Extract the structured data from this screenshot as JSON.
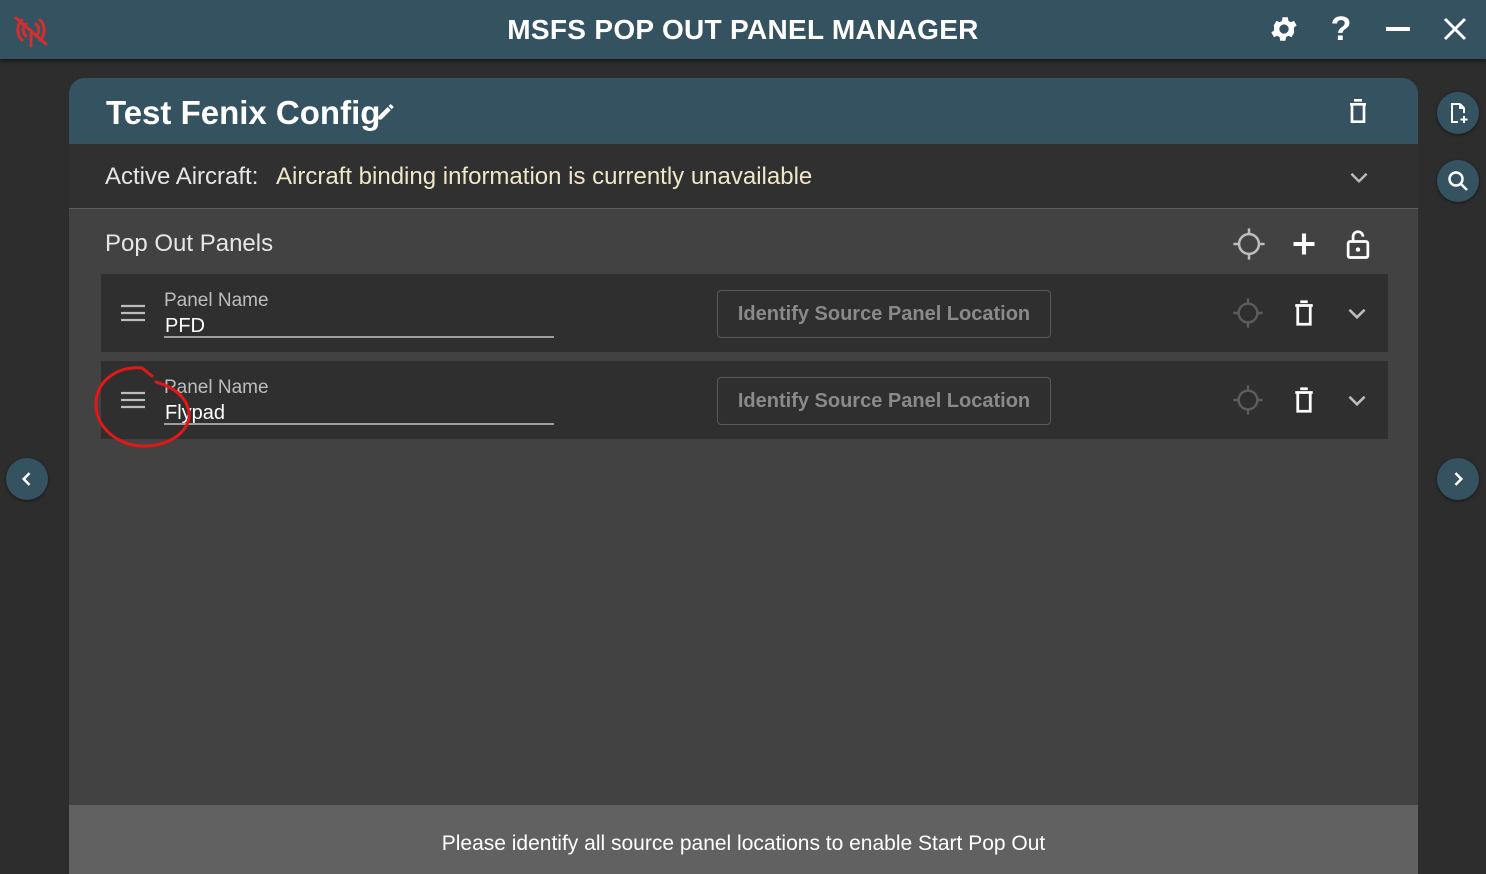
{
  "app": {
    "title": "MSFS POP OUT PANEL MANAGER",
    "accent_color": "#355261",
    "connection_status_color": "#d32f2f"
  },
  "titlebar": {
    "icons": [
      "connection-error-icon",
      "gear-icon",
      "help-icon",
      "minimize-icon",
      "close-icon"
    ]
  },
  "profile": {
    "name": "Test Fenix Config",
    "active_aircraft_label": "Active Aircraft:",
    "active_aircraft_value": "Aircraft binding information is currently unavailable"
  },
  "panels_section": {
    "title": "Pop Out Panels",
    "panels": [
      {
        "field_label": "Panel Name",
        "name": "PFD",
        "identify_label": "Identify Source Panel Location"
      },
      {
        "field_label": "Panel Name",
        "name": "Flypad",
        "identify_label": "Identify Source Panel Location"
      }
    ]
  },
  "footer": {
    "message": "Please identify all source panel locations to enable Start Pop Out"
  }
}
